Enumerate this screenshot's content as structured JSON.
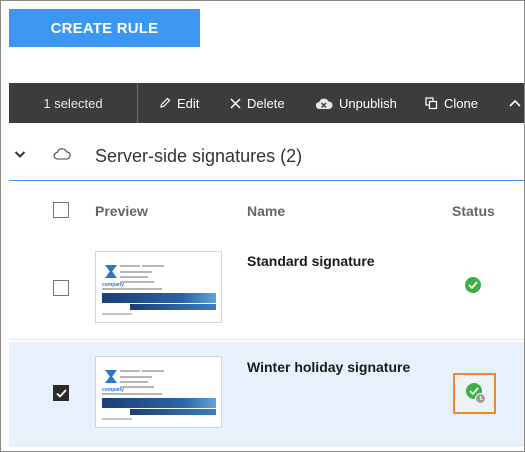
{
  "create_button": {
    "label": "CREATE RULE"
  },
  "toolbar": {
    "selected_text": "1 selected",
    "edit": "Edit",
    "delete": "Delete",
    "unpublish": "Unpublish",
    "clone": "Clone"
  },
  "group": {
    "title": "Server-side signatures (2)",
    "icon": "cloud-icon"
  },
  "columns": {
    "preview": "Preview",
    "name": "Name",
    "status": "Status"
  },
  "rows": [
    {
      "name": "Standard signature",
      "checked": false,
      "status": "published"
    },
    {
      "name": "Winter holiday signature",
      "checked": true,
      "status": "published-scheduled"
    }
  ],
  "thumbnail": {
    "brand": "company"
  },
  "colors": {
    "accent": "#3c97f2",
    "toolbar_bg": "#3c3c3c",
    "selected_row": "#e8f0fb",
    "status_green": "#3fae49",
    "highlight": "#f08a24"
  }
}
